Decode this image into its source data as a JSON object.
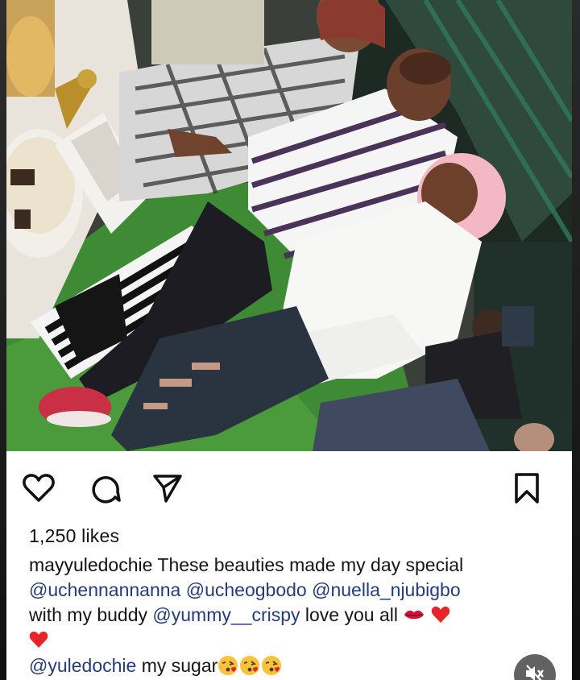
{
  "post": {
    "likes_text": "1,250 likes",
    "caption": {
      "username": "mayyuledochie",
      "text_1": "These beauties made my day special",
      "mention_1": "@uchennannanna",
      "mention_2": "@ucheogbodo",
      "mention_3": "@nuella_njubigbo",
      "text_2": "with my buddy",
      "mention_4": "@yummy__crispy",
      "text_3": "love you all"
    },
    "comment": {
      "mention": "@yuledochie",
      "text": "my sugar"
    },
    "icons": {
      "like": "heart-icon",
      "comment": "comment-icon",
      "share": "send-icon",
      "save": "bookmark-icon",
      "mute": "speaker-muted-icon",
      "emojis": [
        "kiss-mark-icon",
        "red-heart-icon",
        "red-heart-icon",
        "kissing-face-icon",
        "kissing-face-icon",
        "kissing-face-icon"
      ]
    },
    "colors": {
      "mention": "#243c7a",
      "text": "#161616",
      "heart_red": "#e8242b"
    }
  }
}
